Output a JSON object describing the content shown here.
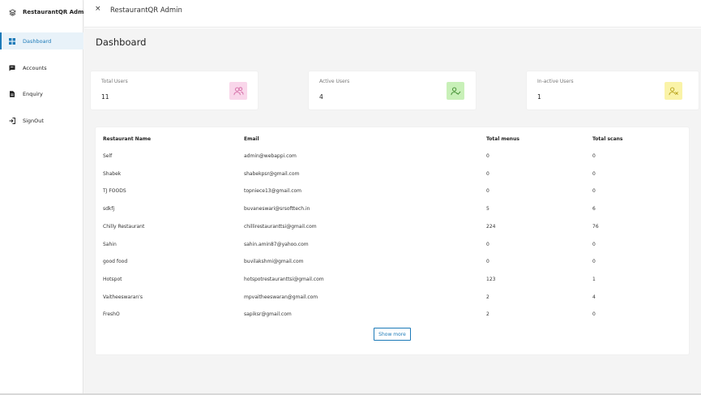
{
  "sidebar": {
    "brand": "RestaurantQR Admin",
    "items": [
      {
        "label": "Dashboard",
        "icon": "grid-icon",
        "active": true
      },
      {
        "label": "Accounts",
        "icon": "chat-icon",
        "active": false
      },
      {
        "label": "Enquiry",
        "icon": "document-icon",
        "active": false
      },
      {
        "label": "SignOut",
        "icon": "signout-icon",
        "active": false
      }
    ]
  },
  "header": {
    "close_icon": "×",
    "title": "RestaurantQR Admin"
  },
  "main": {
    "title": "Dashboard",
    "stats": [
      {
        "label": "Total Users",
        "value": "11",
        "icon": "users-icon",
        "color": "#f9d6ea"
      },
      {
        "label": "Active Users",
        "value": "4",
        "icon": "user-check-icon",
        "color": "#c8f0b8"
      },
      {
        "label": "In-active Users",
        "value": "1",
        "icon": "user-x-icon",
        "color": "#faf3a8"
      }
    ],
    "table": {
      "headers": [
        "Restaurant Name",
        "Email",
        "Total menus",
        "Total scans"
      ],
      "rows": [
        [
          "Self",
          "admin@webappi.com",
          "0",
          "0"
        ],
        [
          "Shabek",
          "shabekpsr@gmail.com",
          "0",
          "0"
        ],
        [
          "TJ FOODS",
          "topniece13@gmail.com",
          "0",
          "0"
        ],
        [
          "sdkfj",
          "buvaneswari@srsofttech.in",
          "5",
          "6"
        ],
        [
          "Chilly Restaurant",
          "chillirestauranttsi@gmail.com",
          "224",
          "76"
        ],
        [
          "Sahin",
          "sahin.amin87@yahoo.com",
          "0",
          "0"
        ],
        [
          "good food",
          "buvilakshmi@gmail.com",
          "0",
          "0"
        ],
        [
          "Hotspot",
          "hotspotrestauranttsi@gmail.com",
          "123",
          "1"
        ],
        [
          "Vaitheeswaran's",
          "mpvaitheeswaran@gmail.com",
          "2",
          "4"
        ],
        [
          "FreshO",
          "sapiksr@gmail.com",
          "2",
          "0"
        ]
      ],
      "show_more": "Show more"
    }
  },
  "colors": {
    "accent": "#1c7ab8",
    "background": "#f4f4f4"
  }
}
